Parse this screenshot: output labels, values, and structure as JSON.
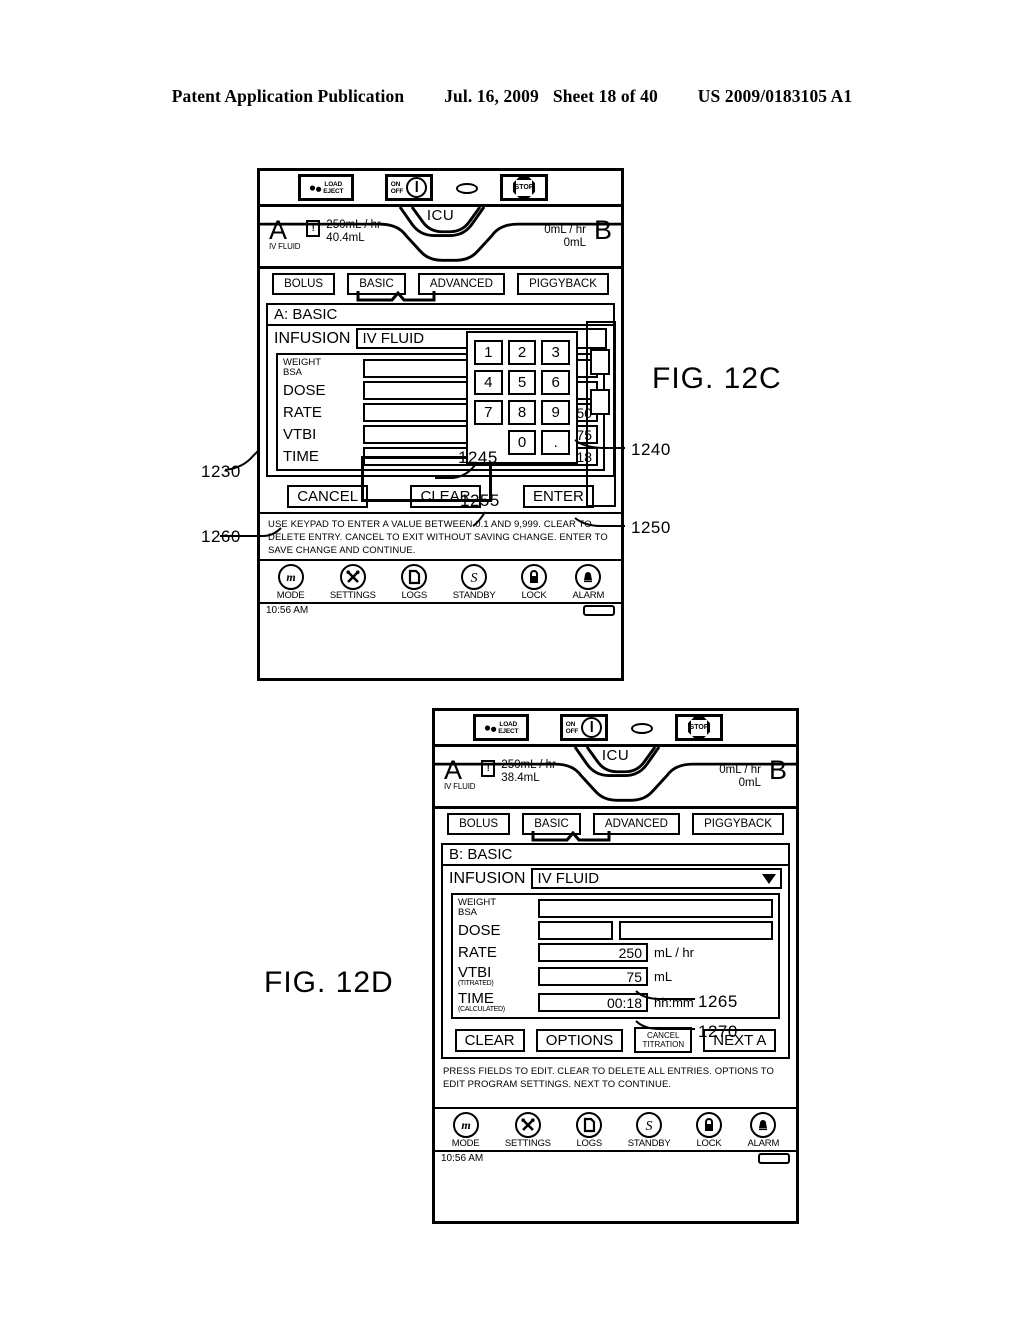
{
  "publication": {
    "left": "Patent Application Publication",
    "date": "Jul. 16, 2009",
    "sheet": "Sheet 18 of 40",
    "number": "US 2009/0183105 A1"
  },
  "figures": {
    "top_label": "FIG. 12C",
    "bottom_label": "FIG. 12D"
  },
  "callouts": {
    "c1230": "1230",
    "c1240": "1240",
    "c1245": "1245",
    "c1250": "1250",
    "c1255": "1255",
    "c1260": "1260",
    "c1265": "1265",
    "c1270": "1270"
  },
  "hardware": {
    "load_eject_line1": "LOAD",
    "load_eject_line2": "EJECT",
    "on_label": "ON",
    "off_label": "OFF",
    "stop_label": "STOP",
    "drops_icon": "droplet-icon",
    "power_icon": "power-icon",
    "oval_icon": "oval-indicator-icon",
    "stop_icon": "stop-octagon-icon"
  },
  "fig12c": {
    "banner": {
      "care_area": "ICU",
      "channel_a_letter": "A",
      "channel_a_sublabel": "IV FLUID",
      "channel_a_alarm_glyph": "!",
      "channel_a_rate": "250mL / hr",
      "channel_a_volume": "40.4mL",
      "channel_b_letter": "B",
      "channel_b_rate": "0mL / hr",
      "channel_b_volume": "0mL"
    },
    "tabs": [
      {
        "label": "BOLUS",
        "selected": false
      },
      {
        "label": "BASIC",
        "selected": true
      },
      {
        "label": "ADVANCED",
        "selected": false
      },
      {
        "label": "PIGGYBACK",
        "selected": false
      }
    ],
    "panel_title": "A: BASIC",
    "infusion_label": "INFUSION",
    "infusion_value": "IV  FLUID",
    "fields": [
      {
        "label": "WEIGHT",
        "sublabel": "BSA",
        "value": "",
        "unit": ""
      },
      {
        "label": "DOSE",
        "sublabel": "",
        "value": "",
        "unit": ""
      },
      {
        "label": "RATE",
        "sublabel": "",
        "value": "250",
        "unit": ""
      },
      {
        "label": "VTBI",
        "sublabel": "",
        "value": "75",
        "unit": ""
      },
      {
        "label": "TIME",
        "sublabel": "",
        "value": "00:18",
        "unit": ""
      }
    ],
    "keypad": [
      "1",
      "2",
      "3",
      "4",
      "5",
      "6",
      "7",
      "8",
      "9",
      "0",
      ".",
      ""
    ],
    "buttons": [
      {
        "label": "CANCEL"
      },
      {
        "label": "CLEAR"
      },
      {
        "label": "ENTER"
      }
    ],
    "instructions": "USE KEYPAD TO ENTER A VALUE BETWEEN 0.1 AND 9,999. CLEAR TO DELETE ENTRY. CANCEL TO EXIT WITHOUT SAVING CHANGE. ENTER TO SAVE CHANGE AND CONTINUE.",
    "softkeys": [
      {
        "label": "MODE",
        "icon": "mode-m-icon",
        "glyph": "m"
      },
      {
        "label": "SETTINGS",
        "icon": "settings-tools-icon",
        "glyph": "✖"
      },
      {
        "label": "LOGS",
        "icon": "logs-page-icon",
        "glyph": "▯"
      },
      {
        "label": "STANDBY",
        "icon": "standby-s-icon",
        "glyph": "S"
      },
      {
        "label": "LOCK",
        "icon": "lock-padlock-icon",
        "glyph": "🔒"
      },
      {
        "label": "ALARM",
        "icon": "alarm-bell-icon",
        "glyph": "🔔"
      }
    ],
    "status_time": "10:56 AM",
    "battery_icon": "battery-icon"
  },
  "fig12d": {
    "banner": {
      "care_area": "ICU",
      "channel_a_letter": "A",
      "channel_a_sublabel": "IV FLUID",
      "channel_a_alarm_glyph": "!",
      "channel_a_rate": "250mL / hr",
      "channel_a_volume": "38.4mL",
      "channel_b_letter": "B",
      "channel_b_rate": "0mL / hr",
      "channel_b_volume": "0mL"
    },
    "tabs": [
      {
        "label": "BOLUS",
        "selected": false
      },
      {
        "label": "BASIC",
        "selected": true
      },
      {
        "label": "ADVANCED",
        "selected": false
      },
      {
        "label": "PIGGYBACK",
        "selected": false
      }
    ],
    "panel_title": "B: BASIC",
    "infusion_label": "INFUSION",
    "infusion_value": "IV  FLUID",
    "fields": [
      {
        "label": "WEIGHT",
        "sublabel": "BSA",
        "value": "",
        "unit": ""
      },
      {
        "label": "DOSE",
        "sublabel": "",
        "value": "",
        "unit": ""
      },
      {
        "label": "RATE",
        "sublabel": "",
        "value": "250",
        "unit": "mL / hr"
      },
      {
        "label": "VTBI",
        "sublabel": "(TITRATED)",
        "value": "75",
        "unit": "mL"
      },
      {
        "label": "TIME",
        "sublabel": "(CALCULATED)",
        "value": "00:18",
        "unit": "hh:mm"
      }
    ],
    "buttons": [
      {
        "label": "CLEAR",
        "line2": ""
      },
      {
        "label": "OPTIONS",
        "line2": ""
      },
      {
        "label": "CANCEL",
        "line2": "TITRATION"
      },
      {
        "label": "NEXT  A",
        "line2": ""
      }
    ],
    "instructions": "PRESS FIELDS TO EDIT. CLEAR TO DELETE ALL ENTRIES. OPTIONS TO EDIT PROGRAM SETTINGS. NEXT TO CONTINUE.",
    "softkeys": [
      {
        "label": "MODE",
        "icon": "mode-m-icon",
        "glyph": "m"
      },
      {
        "label": "SETTINGS",
        "icon": "settings-tools-icon",
        "glyph": "✖"
      },
      {
        "label": "LOGS",
        "icon": "logs-page-icon",
        "glyph": "▯"
      },
      {
        "label": "STANDBY",
        "icon": "standby-s-icon",
        "glyph": "S"
      },
      {
        "label": "LOCK",
        "icon": "lock-padlock-icon",
        "glyph": "🔒"
      },
      {
        "label": "ALARM",
        "icon": "alarm-bell-icon",
        "glyph": "🔔"
      }
    ],
    "status_time": "10:56 AM",
    "battery_icon": "battery-icon"
  }
}
